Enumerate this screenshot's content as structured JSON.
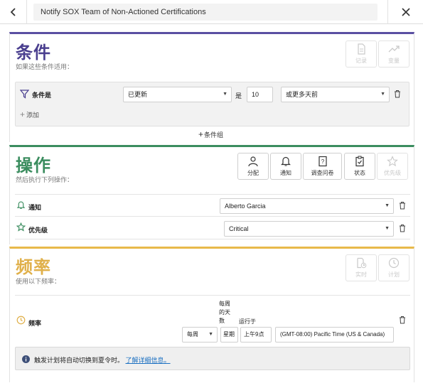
{
  "header": {
    "title": "Notify SOX Team of Non-Actioned Certifications"
  },
  "conditions": {
    "title": "条件",
    "subtitle": "如果这些条件适用：",
    "buttons": {
      "record": "记录",
      "change": "变量"
    },
    "row": {
      "label": "条件是",
      "field_value": "已更新",
      "is_label": "是",
      "number_value": "10",
      "period_value": "或更多天前"
    },
    "add_label": "添加",
    "add_group_label": "条件组"
  },
  "actions": {
    "title": "操作",
    "subtitle": "然后执行下列操作：",
    "buttons": {
      "assign": "分配",
      "notify": "通知",
      "survey": "调查问卷",
      "status": "状态",
      "priority": "优先级"
    },
    "rows": [
      {
        "label": "通知",
        "value": "Alberto Garcia"
      },
      {
        "label": "优先级",
        "value": "Critical"
      }
    ]
  },
  "frequency": {
    "title": "频率",
    "subtitle": "使用以下频率：",
    "buttons": {
      "realtime": "实时",
      "schedule": "计划"
    },
    "row_label": "频率",
    "days_header": "每周的天数",
    "run_at_header": "运行于",
    "interval_value": "每周",
    "day_value": "星期",
    "time_value": "上午9点",
    "timezone_value": "(GMT-08:00) Pacific Time (US & Canada)",
    "info_text": "触发计划将自动切换到夏令时。",
    "info_link": "了解详细信息。"
  }
}
